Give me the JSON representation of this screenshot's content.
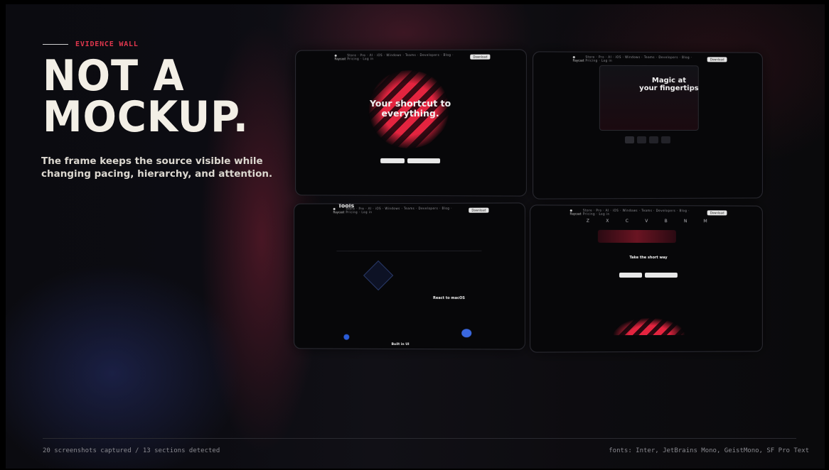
{
  "eyebrow": "EVIDENCE WALL",
  "headline": {
    "line1": "NOT A",
    "line2": "MOCKUP."
  },
  "subtitle": "The frame keeps the source visible while changing pacing, hierarchy, and attention.",
  "footer": {
    "left": "20 screenshots captured / 13 sections detected",
    "right": "fonts: Inter, JetBrains Mono, GeistMono, SF Pro Text"
  },
  "shots": {
    "s1": {
      "title_line1": "Your shortcut to",
      "title_line2": "everything."
    },
    "s2": {
      "title_line1": "Magic at",
      "title_line2": "your fingertips"
    },
    "s3": {
      "heading": "Tools",
      "section": "React to macOS",
      "footer_label": "Built in UI"
    },
    "s4": {
      "keys": [
        "Z",
        "X",
        "C",
        "V",
        "B",
        "N",
        "M"
      ],
      "caption": "Take the short way"
    }
  }
}
